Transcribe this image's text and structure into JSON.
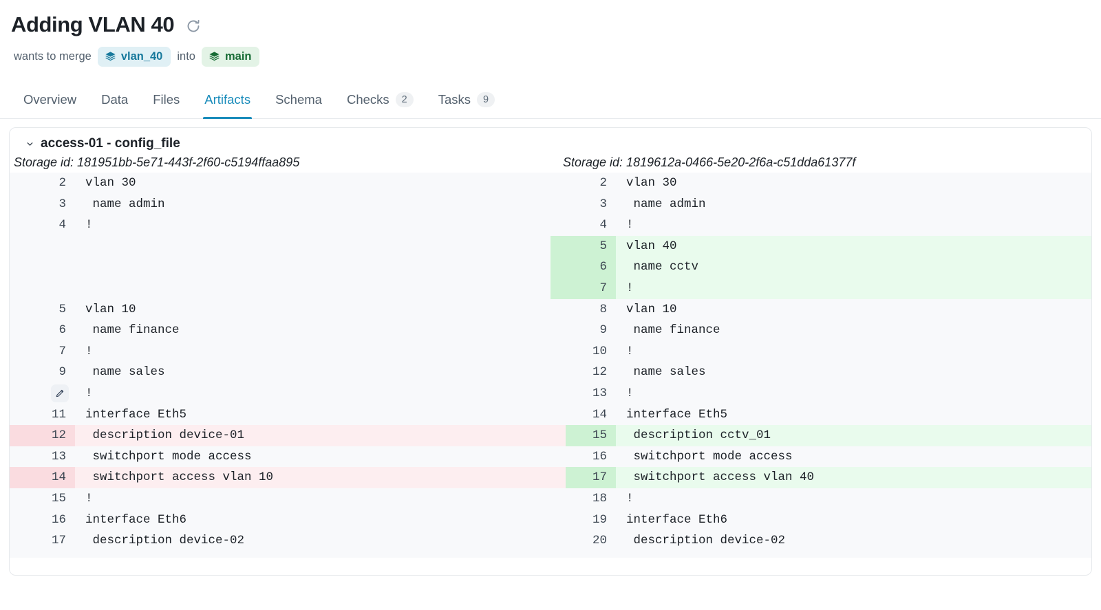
{
  "header": {
    "title": "Adding VLAN 40",
    "refresh_icon": "refresh-icon",
    "merge_prefix": "wants to merge",
    "source_branch": "vlan_40",
    "into": "into",
    "target_branch": "main",
    "source_color": "#17799c",
    "target_color": "#176c35"
  },
  "tabs": [
    {
      "label": "Overview",
      "badge": null,
      "active": false
    },
    {
      "label": "Data",
      "badge": null,
      "active": false
    },
    {
      "label": "Files",
      "badge": null,
      "active": false
    },
    {
      "label": "Artifacts",
      "badge": null,
      "active": true
    },
    {
      "label": "Schema",
      "badge": null,
      "active": false
    },
    {
      "label": "Checks",
      "badge": "2",
      "active": false
    },
    {
      "label": "Tasks",
      "badge": "9",
      "active": false
    }
  ],
  "accent_color": "#1a8cbb",
  "artifact": {
    "title": "access-01 - config_file",
    "collapse_icon": "chevron-down-icon",
    "storage_id_left": "Storage id: 181951bb-5e71-443f-2f60-c5194ffaa895",
    "storage_id_right": "Storage id: 1819612a-0466-5e20-2f6a-c51dda61377f"
  },
  "diff": {
    "left": [
      {
        "num": "2",
        "code": "vlan 30",
        "state": "ctx"
      },
      {
        "num": "3",
        "code": " name admin",
        "state": "ctx"
      },
      {
        "num": "4",
        "code": "!",
        "state": "ctx"
      },
      {
        "num": "",
        "code": "",
        "state": "blank"
      },
      {
        "num": "",
        "code": "",
        "state": "blank"
      },
      {
        "num": "",
        "code": "",
        "state": "blank"
      },
      {
        "num": "5",
        "code": "vlan 10",
        "state": "ctx"
      },
      {
        "num": "6",
        "code": " name finance",
        "state": "ctx"
      },
      {
        "num": "7",
        "code": "!",
        "state": "ctx"
      },
      {
        "num": "9",
        "code": " name sales",
        "state": "ctx"
      },
      {
        "num": "",
        "code": "!",
        "state": "ctx",
        "icon": "edit-pencil-icon"
      },
      {
        "num": "11",
        "code": "interface Eth5",
        "state": "ctx"
      },
      {
        "num": "12",
        "code": " description device-01",
        "state": "rem"
      },
      {
        "num": "13",
        "code": " switchport mode access",
        "state": "ctx"
      },
      {
        "num": "14",
        "code": " switchport access vlan 10",
        "state": "rem"
      },
      {
        "num": "15",
        "code": "!",
        "state": "ctx"
      },
      {
        "num": "16",
        "code": "interface Eth6",
        "state": "ctx"
      },
      {
        "num": "17",
        "code": " description device-02",
        "state": "ctx"
      }
    ],
    "right": [
      {
        "num": "2",
        "code": "vlan 30",
        "state": "ctx"
      },
      {
        "num": "3",
        "code": " name admin",
        "state": "ctx"
      },
      {
        "num": "4",
        "code": "!",
        "state": "ctx"
      },
      {
        "num": "5",
        "code": "vlan 40",
        "state": "add"
      },
      {
        "num": "6",
        "code": " name cctv",
        "state": "add"
      },
      {
        "num": "7",
        "code": "!",
        "state": "add"
      },
      {
        "num": "8",
        "code": "vlan 10",
        "state": "ctx"
      },
      {
        "num": "9",
        "code": " name finance",
        "state": "ctx"
      },
      {
        "num": "10",
        "code": "!",
        "state": "ctx"
      },
      {
        "num": "12",
        "code": " name sales",
        "state": "ctx"
      },
      {
        "num": "13",
        "code": "!",
        "state": "ctx"
      },
      {
        "num": "14",
        "code": "interface Eth5",
        "state": "ctx"
      },
      {
        "num": "15",
        "code": " description cctv_01",
        "state": "add",
        "seam": true
      },
      {
        "num": "16",
        "code": " switchport mode access",
        "state": "ctx"
      },
      {
        "num": "17",
        "code": " switchport access vlan 40",
        "state": "add",
        "seam": true
      },
      {
        "num": "18",
        "code": "!",
        "state": "ctx"
      },
      {
        "num": "19",
        "code": "interface Eth6",
        "state": "ctx"
      },
      {
        "num": "20",
        "code": " description device-02",
        "state": "ctx"
      }
    ]
  },
  "colors": {
    "removed_gutter": "#fadce0",
    "removed_bg": "#fdeef0",
    "added_gutter": "#cdf2d3",
    "added_bg": "#e9fbed",
    "pane_bg": "#f8f9fb"
  }
}
